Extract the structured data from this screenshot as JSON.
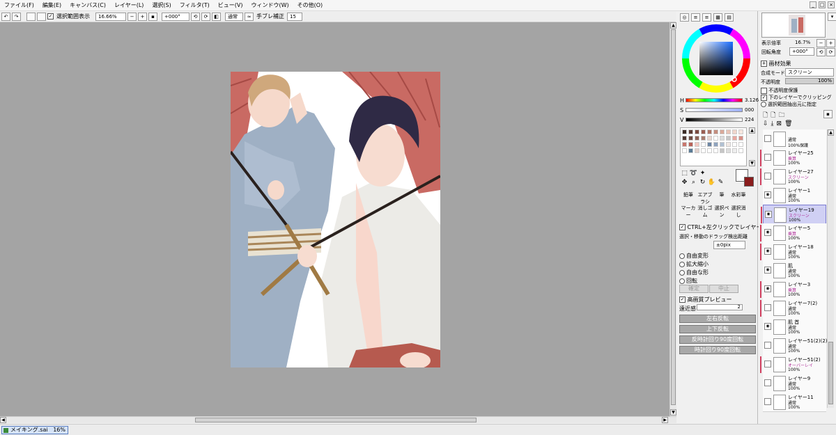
{
  "menu": [
    "ファイル(F)",
    "編集(E)",
    "キャンバス(C)",
    "レイヤー(L)",
    "選択(S)",
    "フィルタ(T)",
    "ビュー(V)",
    "ウィンドウ(W)",
    "その他(O)"
  ],
  "toolbar": {
    "selection_source_label": "選択範囲表示",
    "zoom_value": "16.66%",
    "rotation_value": "+000°",
    "blend_value": "通常",
    "stabilizer_label": "手ブレ補正",
    "stabilizer_value": "15"
  },
  "navigator": {
    "zoom_label": "表示倍率",
    "zoom_value": "16.7%",
    "rotation_label": "回転角度",
    "rotation_value": "+000°"
  },
  "layer_props": {
    "paper_effect_label": "画材効果",
    "blend_mode_label": "合成モード",
    "blend_mode_value": "スクリーン",
    "opacity_label": "不透明度",
    "opacity_value": "100%",
    "preserve_opacity_label": "不透明度保護",
    "clipping_label": "下のレイヤーでクリッピング",
    "selection_source_label": "選択範囲抽出元に指定"
  },
  "color": {
    "h_label": "H",
    "h_value": "3.126",
    "s_label": "S",
    "s_value": "000",
    "v_label": "V",
    "v_value": "224",
    "hue_fraction": 0.01,
    "sat_fraction": 0.0,
    "val_fraction": 0.88,
    "primary": "#ffffff",
    "secondary": "#8a1c1c"
  },
  "swatches": [
    "#3a2b25",
    "#5c3d35",
    "#7a4a3f",
    "#9b5e52",
    "#b07566",
    "#c48d7e",
    "#d9a99a",
    "#e8c3b6",
    "#f0d6cc",
    "#f6e6df",
    "#4f3a34",
    "#6f4d44",
    "#8e6357",
    "#a87d70",
    "#e9d6cf",
    "#ffffff",
    "#dcdcdc",
    "#c7c7c7",
    "#e8a8a0",
    "#d88f86",
    "#c9776e",
    "#b96259",
    "#f2c7c1",
    "#ffffff",
    "#6d86a4",
    "#8ea3be",
    "#b1c0d3",
    "#f1e8e4",
    "#ffffff",
    "#ffffff",
    "#ffffff",
    "#5a7a95",
    "#e3d2cd",
    "#ffffff",
    "#ffffff",
    "#ffffff",
    "#c5c5c5",
    "#dddddd",
    "#eeeeee",
    "#ffffff"
  ],
  "tools": {
    "pencil": "鉛筆",
    "airbrush": "エアブラシ",
    "brush": "筆",
    "watercolor": "水彩筆",
    "marker": "マーカー",
    "eraser": "消しゴム",
    "select_pen": "選択ペン",
    "select_eraser": "選択消し"
  },
  "move_options": {
    "ctrl_click_label": "CTRL+左クリックでレイヤー選択",
    "drag_threshold_label": "選択・移動のドラッグ検出距離",
    "drag_threshold_value": "±0pix",
    "free_transform": "自由変形",
    "scale": "拡大縮小",
    "free_shape": "自由な形",
    "rotate": "回転",
    "ok": "確定",
    "cancel": "中止",
    "hq_preview_label": "高画質プレビュー",
    "perspective_label": "遠近感",
    "perspective_value": "2",
    "flip_h": "左右反転",
    "flip_v": "上下反転",
    "rotate_ccw": "反時計回り90度回転",
    "rotate_cw": "時計回り90度回転"
  },
  "layers": [
    {
      "name": "",
      "mode": "通常",
      "opacity": "100%保護",
      "marked": false,
      "visible": false,
      "selected": false
    },
    {
      "name": "レイヤー25",
      "mode": "乗算",
      "opacity": "100%",
      "marked": true,
      "visible": false,
      "selected": false
    },
    {
      "name": "レイヤー27",
      "mode": "スクリーン",
      "opacity": "100%",
      "marked": true,
      "visible": false,
      "selected": false
    },
    {
      "name": "レイヤー1",
      "mode": "通常",
      "opacity": "100%",
      "marked": false,
      "visible": true,
      "selected": false
    },
    {
      "name": "レイヤー19",
      "mode": "スクリーン",
      "opacity": "100%",
      "marked": true,
      "visible": true,
      "selected": true
    },
    {
      "name": "レイヤー5",
      "mode": "乗算",
      "opacity": "100%",
      "marked": true,
      "visible": true,
      "selected": false
    },
    {
      "name": "レイヤー18",
      "mode": "通常",
      "opacity": "100%",
      "marked": true,
      "visible": true,
      "selected": false
    },
    {
      "name": "肌",
      "mode": "通常",
      "opacity": "100%",
      "marked": false,
      "visible": true,
      "selected": false
    },
    {
      "name": "レイヤー3",
      "mode": "乗算",
      "opacity": "100%",
      "marked": true,
      "visible": true,
      "selected": false
    },
    {
      "name": "レイヤー7(2)",
      "mode": "通常",
      "opacity": "100%",
      "marked": true,
      "visible": false,
      "selected": false
    },
    {
      "name": "肌 首",
      "mode": "通常",
      "opacity": "100%",
      "marked": false,
      "visible": true,
      "selected": false
    },
    {
      "name": "レイヤー51(2)(2)",
      "mode": "通常",
      "opacity": "100%",
      "marked": false,
      "visible": false,
      "selected": false
    },
    {
      "name": "レイヤー51(2)",
      "mode": "オーバーレイ",
      "opacity": "100%",
      "marked": true,
      "visible": false,
      "selected": false
    },
    {
      "name": "レイヤー9",
      "mode": "通常",
      "opacity": "100%",
      "marked": false,
      "visible": false,
      "selected": false
    },
    {
      "name": "レイヤー11",
      "mode": "通常",
      "opacity": "100%",
      "marked": false,
      "visible": false,
      "selected": false
    }
  ],
  "status": {
    "doc_name": "メイキング.sai",
    "doc_zoom": "16%"
  }
}
